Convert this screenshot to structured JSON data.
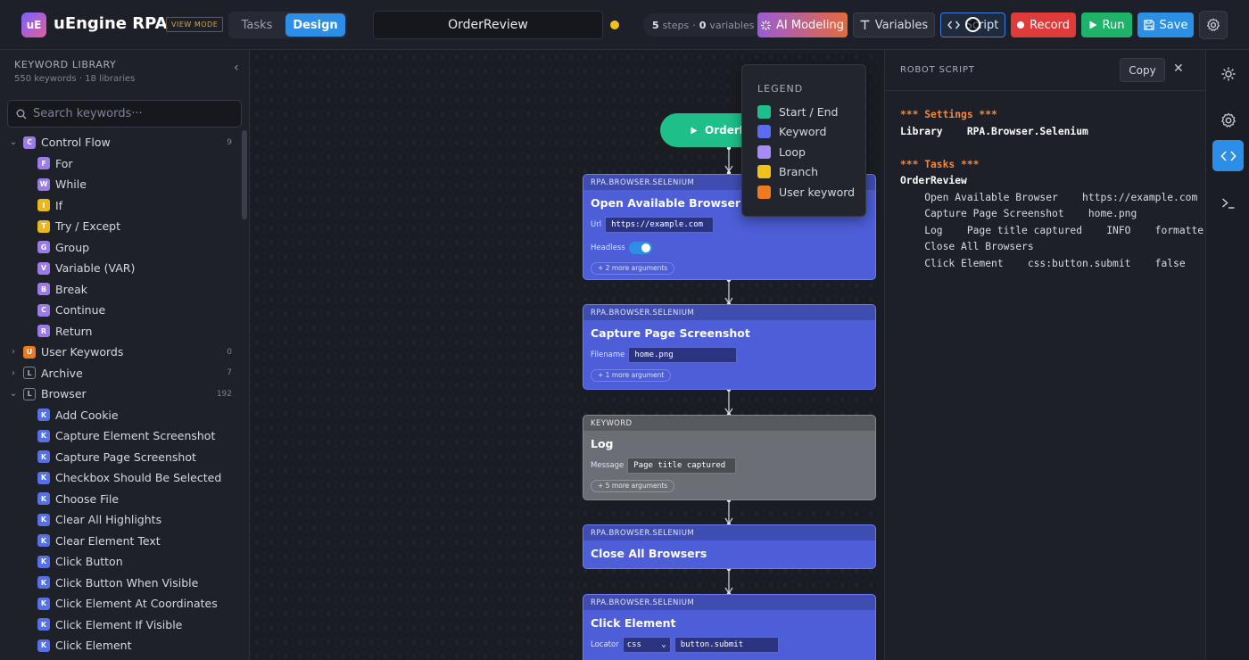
{
  "header": {
    "logo_text": "uE",
    "app_title": "uEngine RPA",
    "view_mode": "VIEW MODE",
    "tabs": {
      "tasks": "Tasks",
      "design": "Design"
    },
    "task_name": "OrderReview",
    "stats": {
      "steps_count": "5",
      "steps_label": "steps",
      "sep": "·",
      "vars_count": "0",
      "vars_label": "variables"
    },
    "buttons": {
      "ai": "AI Modeling",
      "variables": "Variables",
      "script": "Script",
      "record": "Record",
      "run": "Run",
      "save": "Save"
    }
  },
  "sidebar": {
    "title": "KEYWORD LIBRARY",
    "subtitle": "550 keywords · 18 libraries",
    "search_placeholder": "Search keywords···",
    "control_flow": {
      "letter": "C",
      "label": "Control Flow",
      "count": "9"
    },
    "control_items": [
      {
        "letter": "F",
        "label": "For"
      },
      {
        "letter": "W",
        "label": "While"
      },
      {
        "letter": "I",
        "label": "If"
      },
      {
        "letter": "T",
        "label": "Try / Except"
      },
      {
        "letter": "G",
        "label": "Group"
      },
      {
        "letter": "V",
        "label": "Variable (VAR)"
      },
      {
        "letter": "B",
        "label": "Break"
      },
      {
        "letter": "C",
        "label": "Continue"
      },
      {
        "letter": "R",
        "label": "Return"
      }
    ],
    "user_keywords": {
      "letter": "U",
      "label": "User Keywords",
      "count": "0"
    },
    "archive": {
      "letter": "L",
      "label": "Archive",
      "count": "7"
    },
    "browser": {
      "letter": "L",
      "label": "Browser",
      "count": "192"
    },
    "browser_items": [
      {
        "letter": "K",
        "label": "Add Cookie"
      },
      {
        "letter": "K",
        "label": "Capture Element Screenshot"
      },
      {
        "letter": "K",
        "label": "Capture Page Screenshot"
      },
      {
        "letter": "K",
        "label": "Checkbox Should Be Selected"
      },
      {
        "letter": "K",
        "label": "Choose File"
      },
      {
        "letter": "K",
        "label": "Clear All Highlights"
      },
      {
        "letter": "K",
        "label": "Clear Element Text"
      },
      {
        "letter": "K",
        "label": "Click Button"
      },
      {
        "letter": "K",
        "label": "Click Button When Visible"
      },
      {
        "letter": "K",
        "label": "Click Element At Coordinates"
      },
      {
        "letter": "K",
        "label": "Click Element If Visible"
      },
      {
        "letter": "K",
        "label": "Click Element"
      }
    ]
  },
  "canvas": {
    "start_label": "OrderReview",
    "nodes": [
      {
        "lib": "RPA.BROWSER.SELENIUM",
        "title": "Open Available Browser",
        "arg1_label": "Url",
        "arg1_value": "https://example.com",
        "arg2_label": "Headless",
        "more": "+ 2 more arguments"
      },
      {
        "lib": "RPA.BROWSER.SELENIUM",
        "title": "Capture Page Screenshot",
        "arg1_label": "Filename",
        "arg1_value": "home.png",
        "more": "+ 1 more argument"
      },
      {
        "lib": "KEYWORD",
        "title": "Log",
        "arg1_label": "Message",
        "arg1_value": "Page title captured",
        "more": "+ 5 more arguments"
      },
      {
        "lib": "RPA.BROWSER.SELENIUM",
        "title": "Close All Browsers"
      },
      {
        "lib": "RPA.BROWSER.SELENIUM",
        "title": "Click Element",
        "arg1_label": "Locator",
        "arg1_select": "css",
        "arg1_value": "button.submit"
      }
    ],
    "legend": {
      "title": "LEGEND",
      "items": [
        {
          "label": "Start / End",
          "color": "#1fbf8a"
        },
        {
          "label": "Keyword",
          "color": "#5b6cf0"
        },
        {
          "label": "Loop",
          "color": "#a78bfa"
        },
        {
          "label": "Branch",
          "color": "#f2c21b"
        },
        {
          "label": "User keyword",
          "color": "#f07b1e"
        }
      ]
    }
  },
  "script_panel": {
    "title": "ROBOT SCRIPT",
    "copy": "Copy",
    "settings_header": "*** Settings ***",
    "library_line": "Library    RPA.Browser.Selenium",
    "tasks_header": "*** Tasks ***",
    "task_name": "OrderReview",
    "lines": [
      "    Open Available Browser    https://example.com",
      "    Capture Page Screenshot    home.png",
      "    Log    Page title captured    INFO    formatter",
      "    Close All Browsers",
      "    Click Element    css:button.submit    false"
    ]
  },
  "colors": {
    "accent": "#2d8ee8",
    "keyword_node": "#4d5ed8",
    "start_node": "#1fbf8a",
    "record": "#e03b3b",
    "run": "#1fb36a"
  }
}
